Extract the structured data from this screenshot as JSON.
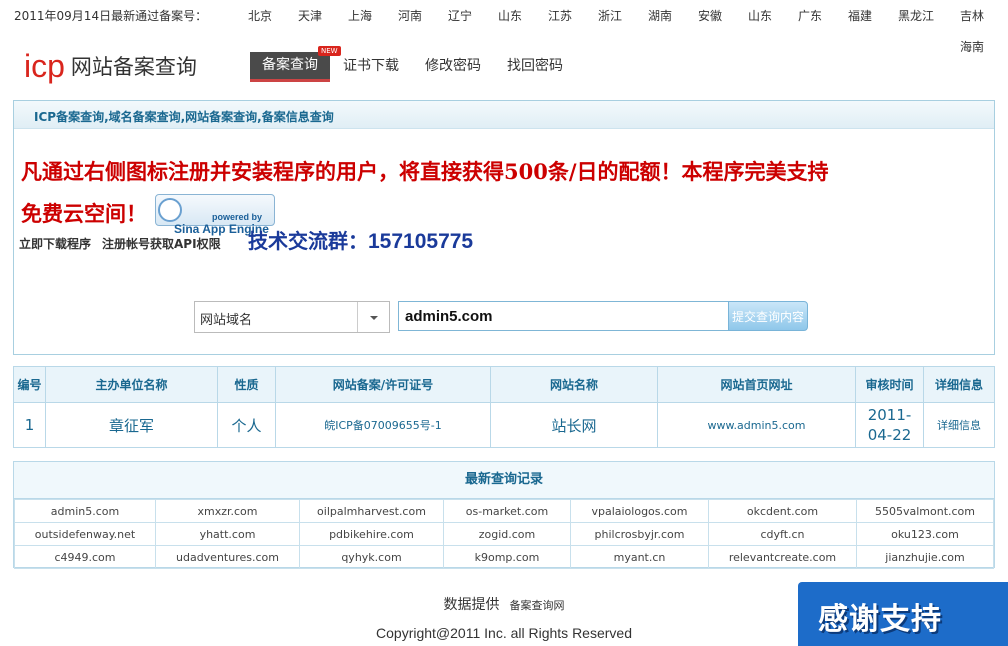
{
  "topbar": {
    "date_text": "2011年09月14日最新通过备案号：",
    "provinces": [
      "北京",
      "天津",
      "上海",
      "河南",
      "辽宁",
      "山东",
      "江苏",
      "浙江",
      "湖南",
      "安徽",
      "山东",
      "广东",
      "福建",
      "黑龙江",
      "吉林"
    ],
    "overflow_province": "海南"
  },
  "header": {
    "logo_icp": "icp",
    "logo_text": "网站备案查询",
    "nav_active": "备案查询",
    "new_badge": "NEW",
    "nav_items": [
      "证书下载",
      "修改密码",
      "找回密码"
    ]
  },
  "panel": {
    "title": "ICP备案查询,域名备案查询,网站备案查询,备案信息查询",
    "promo_line1": "凡通过右侧图标注册并安装程序的用户，将直接获得500条/日的配额！本程序完美支持",
    "promo_line2": "免费云空间！",
    "sae_powered": "powered by",
    "sae_name": "Sina App Engine",
    "link_download": "立即下载程序",
    "link_register": "注册帐号获取API权限",
    "qq_label": "技术交流群：",
    "qq_number": "157105775",
    "search_type": "网站域名",
    "search_value": "admin5.com",
    "submit_label": "提交查询内容"
  },
  "result": {
    "headers": [
      "编号",
      "主办单位名称",
      "性质",
      "网站备案/许可证号",
      "网站名称",
      "网站首页网址",
      "审核时间",
      "详细信息"
    ],
    "row": [
      "1",
      "章征军",
      "个人",
      "皖ICP备07009655号-1",
      "站长网",
      "www.admin5.com",
      "2011-04-22",
      "详细信息"
    ]
  },
  "recent": {
    "title": "最新查询记录",
    "rows": [
      [
        "admin5.com",
        "xmxzr.com",
        "oilpalmharvest.com",
        "os-market.com",
        "vpalaiologos.com",
        "okcdent.com",
        "5505valmont.com"
      ],
      [
        "outsidefenway.net",
        "yhatt.com",
        "pdbikehire.com",
        "zogid.com",
        "philcrosbyjr.com",
        "cdyft.cn",
        "oku123.com"
      ],
      [
        "c4949.com",
        "udadventures.com",
        "qyhyk.com",
        "k9omp.com",
        "myant.cn",
        "relevantcreate.com",
        "jianzhujie.com"
      ]
    ]
  },
  "footer": {
    "data_label": "数据提供",
    "data_source": "备案查询网",
    "copyright": "Copyright@2011 Inc. all Rights Reserved"
  },
  "thanks": "感谢支持"
}
